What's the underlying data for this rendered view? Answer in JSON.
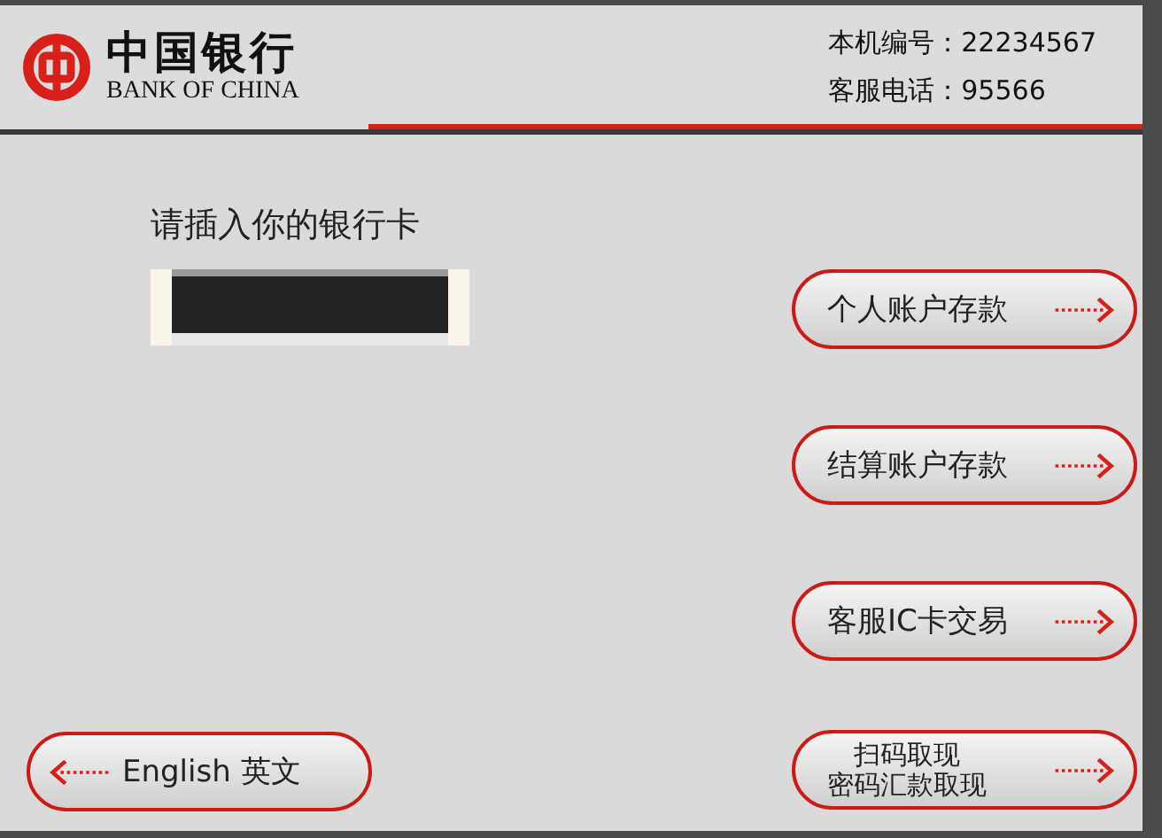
{
  "header": {
    "bank_name": "中国银行",
    "bank_name_en": "BANK OF CHINA",
    "info": [
      "本机编号：22234567",
      "客服电话：95566"
    ]
  },
  "prompt": "请插入你的银行卡",
  "buttons": [
    {
      "kind": "back",
      "lines": [
        "English  英文"
      ]
    },
    {
      "kind": "next",
      "lines": [
        "个人账户存款"
      ]
    },
    {
      "kind": "next",
      "lines": [
        "结算账户存款"
      ]
    },
    {
      "kind": "next",
      "lines": [
        "客服IC卡交易"
      ]
    },
    {
      "kind": "next",
      "lines": [
        "扫码取现",
        "密码汇款取现"
      ]
    }
  ]
}
